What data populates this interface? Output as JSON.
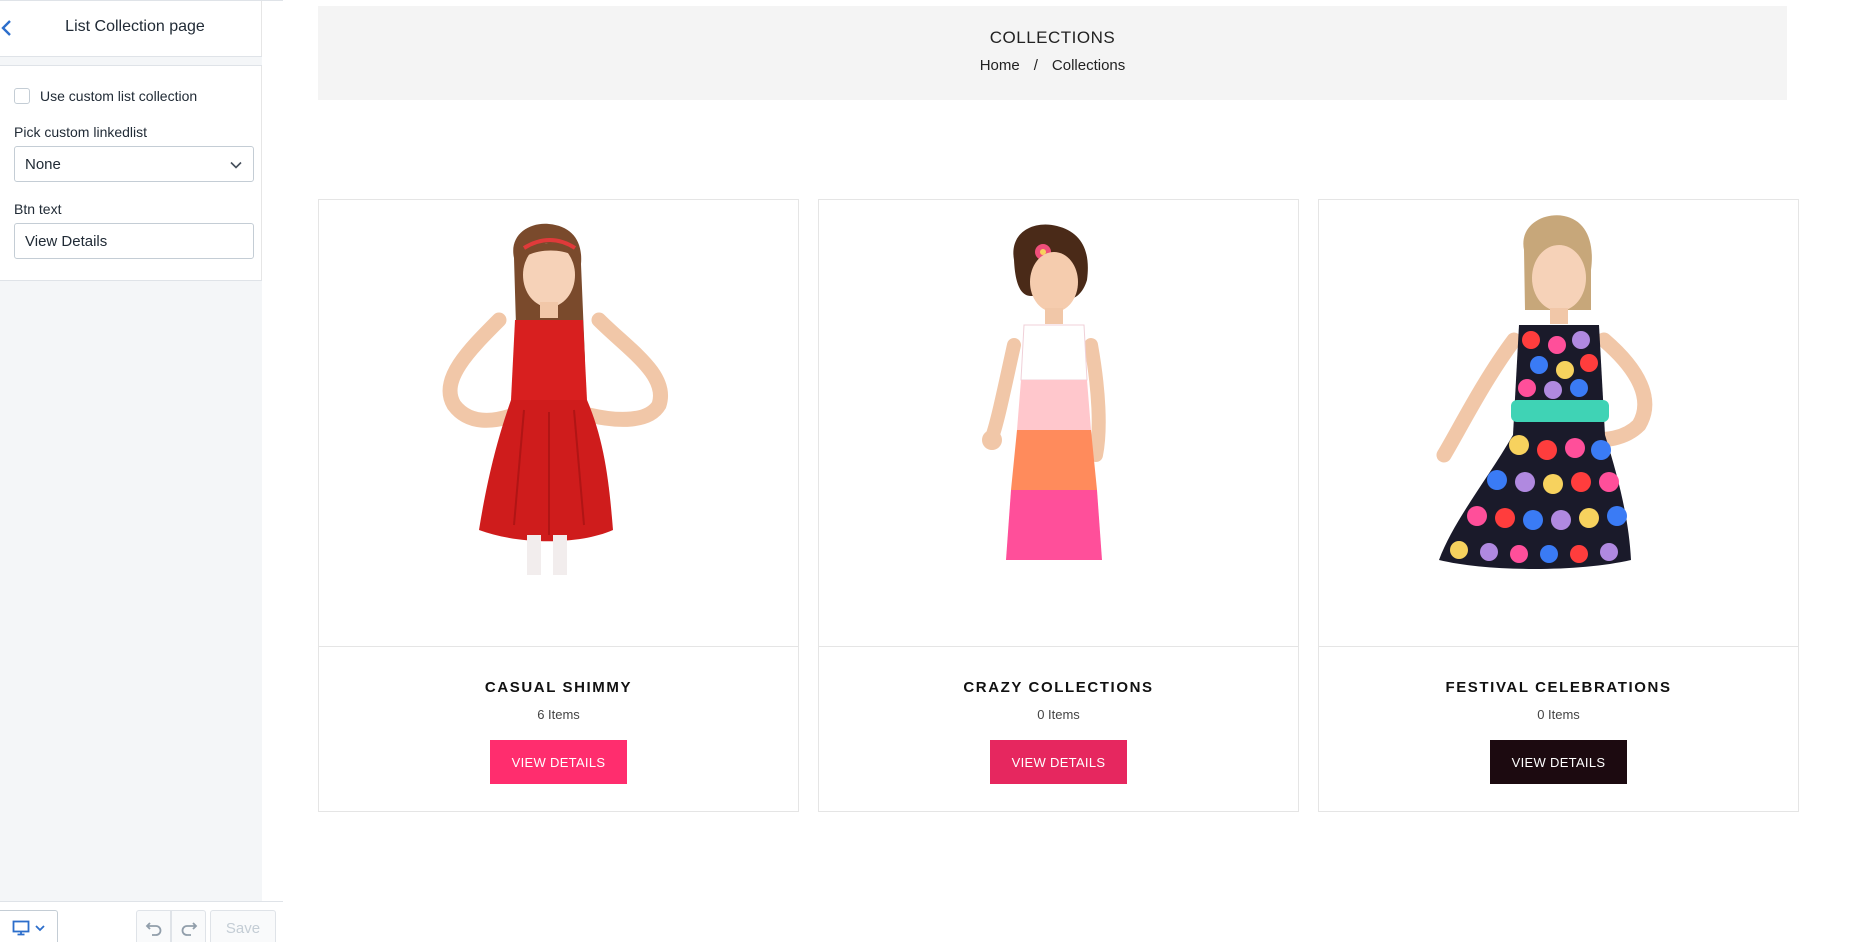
{
  "editor": {
    "title": "List Collection page",
    "use_custom_label": "Use custom list collection",
    "use_custom_checked": false,
    "pick_label": "Pick custom linkedlist",
    "pick_value": "None",
    "btn_text_label": "Btn text",
    "btn_text_value": "View Details",
    "save_label": "Save"
  },
  "banner": {
    "title": "COLLECTIONS",
    "crumb_home": "Home",
    "crumb_sep": "/",
    "crumb_current": "Collections"
  },
  "collections": [
    {
      "name": "CASUAL SHIMMY",
      "count": "6 Items",
      "button": "VIEW DETAILS",
      "button_color": "#ff2d6e",
      "dress_color": "#d81f1f",
      "hair_color": "#7a4a2c"
    },
    {
      "name": "CRAZY COLLECTIONS",
      "count": "0 Items",
      "button": "VIEW DETAILS",
      "button_color": "#e6275f",
      "dress_color": "#ff8b5c",
      "hair_color": "#4a2a18"
    },
    {
      "name": "FESTIVAL CELEBRATIONS",
      "count": "0 Items",
      "button": "VIEW DETAILS",
      "button_color": "#1c0a10",
      "dress_color": "#1a1a2a",
      "hair_color": "#c7a77a"
    }
  ],
  "icons": {
    "back": "chevron-left-icon",
    "select": "chevron-down-icon",
    "device": "desktop-icon",
    "undo": "undo-icon",
    "redo": "redo-icon"
  }
}
